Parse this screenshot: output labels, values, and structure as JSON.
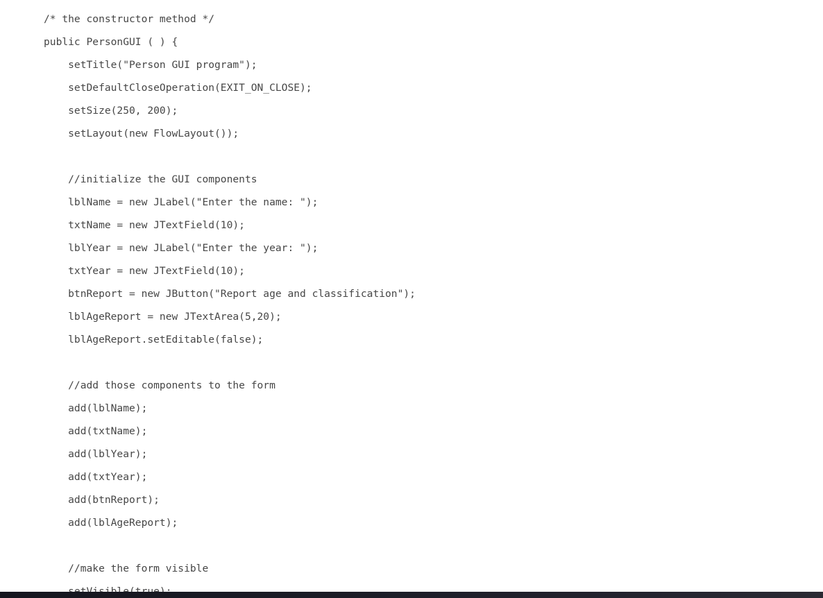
{
  "document": {
    "kind": "code-listing",
    "language": "Java",
    "text_color": "#464646",
    "background_color": "#ffffff",
    "bottom_bar_color": "#1b1c26",
    "lines": [
      "/* the constructor method */",
      "public PersonGUI ( ) {",
      "    setTitle(\"Person GUI program\");",
      "    setDefaultCloseOperation(EXIT_ON_CLOSE);",
      "    setSize(250, 200);",
      "    setLayout(new FlowLayout());",
      "",
      "    //initialize the GUI components",
      "    lblName = new JLabel(\"Enter the name: \");",
      "    txtName = new JTextField(10);",
      "    lblYear = new JLabel(\"Enter the year: \");",
      "    txtYear = new JTextField(10);",
      "    btnReport = new JButton(\"Report age and classification\");",
      "    lblAgeReport = new JTextArea(5,20);",
      "    lblAgeReport.setEditable(false);",
      "",
      "    //add those components to the form",
      "    add(lblName);",
      "    add(txtName);",
      "    add(lblYear);",
      "    add(txtYear);",
      "    add(btnReport);",
      "    add(lblAgeReport);",
      "",
      "    //make the form visible",
      "    setVisible(true);"
    ]
  }
}
